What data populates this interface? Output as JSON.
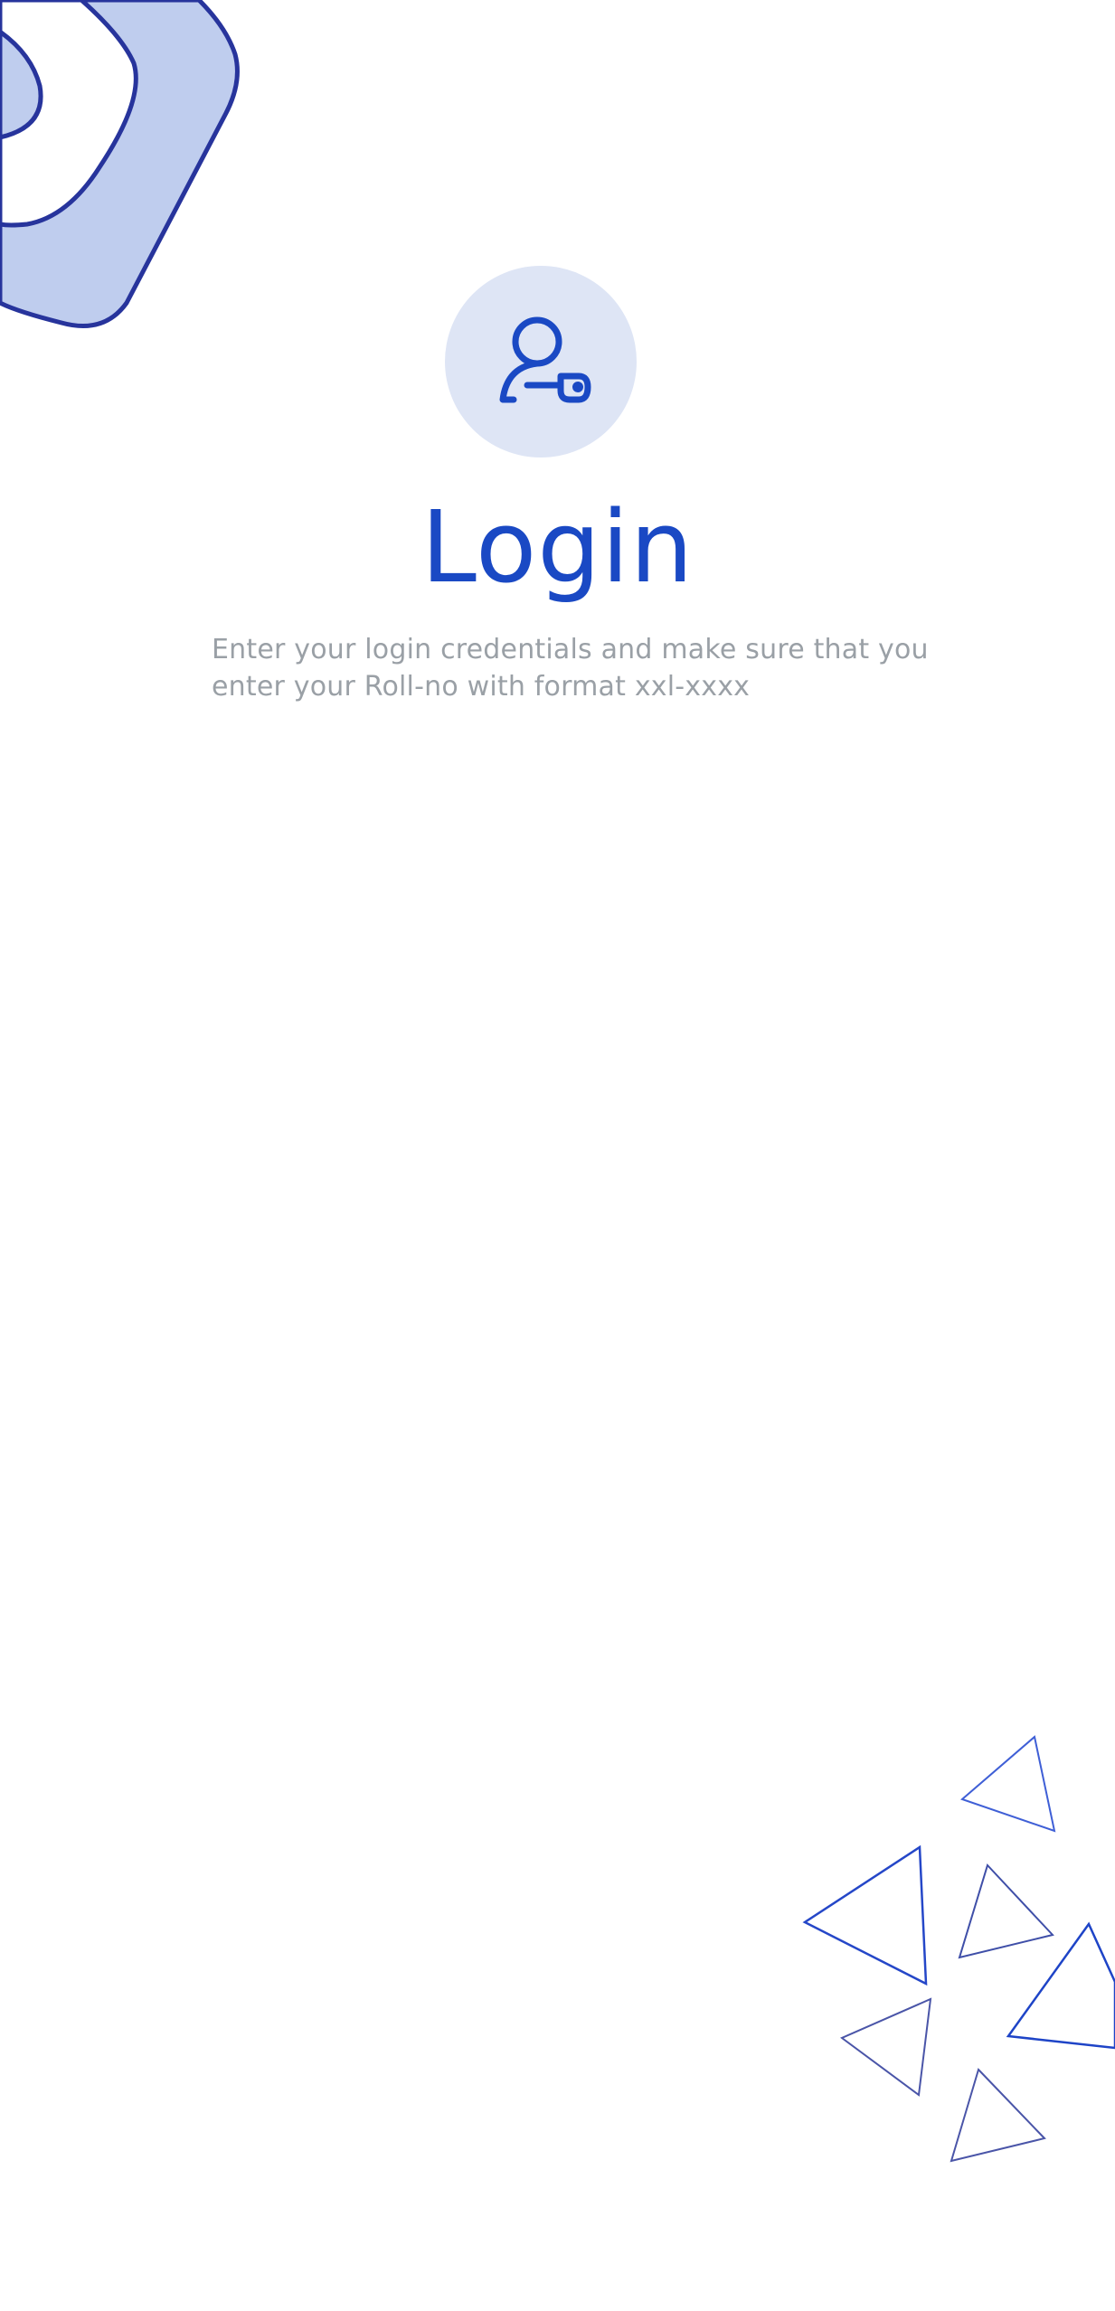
{
  "screen": {
    "title": "Login",
    "description": "Enter your login credentials and make sure that you enter your Roll-no with format xxl-xxxx"
  },
  "icons": {
    "login_icon": "user-key-icon",
    "top_decoration": "abstract-blob-shape",
    "bottom_decoration": "triangles-pattern"
  },
  "colors": {
    "accent": "#1a49c4",
    "icon_circle_bg": "#dee5f5",
    "subtitle_text": "#9aa0a6",
    "blob_fill": "#bfcdee",
    "blob_stroke": "#27349c",
    "background": "#ffffff"
  }
}
